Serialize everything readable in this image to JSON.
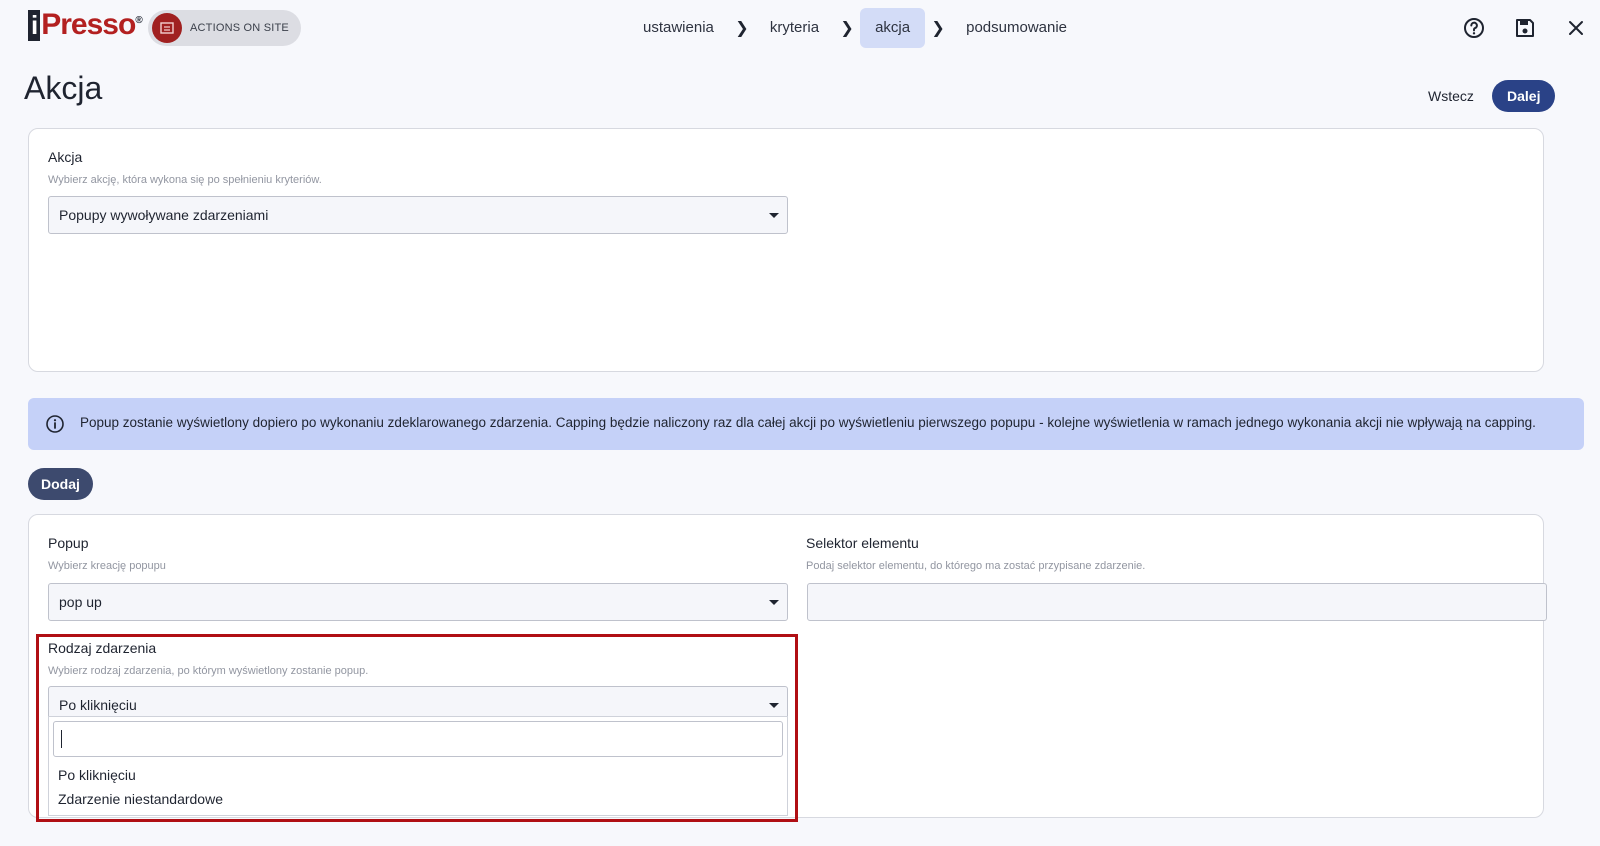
{
  "header": {
    "logo_text": "Presso",
    "logo_mark": "i",
    "logo_reg": "®",
    "badge_label": "ACTIONS ON SITE",
    "steps": [
      {
        "label": "ustawienia"
      },
      {
        "label": "kryteria"
      },
      {
        "label": "akcja",
        "active": true
      },
      {
        "label": "podsumowanie"
      }
    ],
    "icons": [
      "help-icon",
      "save-icon",
      "close-icon"
    ]
  },
  "page": {
    "title": "Akcja",
    "back_label": "Wstecz",
    "next_label": "Dalej"
  },
  "action_card": {
    "label": "Akcja",
    "hint": "Wybierz akcję, która wykona się po spełnieniu kryteriów.",
    "select_value": "Popupy wywoływane zdarzeniami"
  },
  "info": {
    "text": "Popup zostanie wyświetlony dopiero po wykonaniu zdeklarowanego zdarzenia. Capping będzie naliczony raz dla całej akcji po wyświetleniu pierwszego popupu - kolejne wyświetlenia w ramach jednego wykonania akcji nie wpływają na capping."
  },
  "add_label": "Dodaj",
  "popup_card": {
    "popup": {
      "label": "Popup",
      "hint": "Wybierz kreację popupu",
      "value": "pop up"
    },
    "selector": {
      "label": "Selektor elementu",
      "hint": "Podaj selektor elementu, do którego ma zostać przypisane zdarzenie.",
      "value": ""
    },
    "event_type": {
      "label": "Rodzaj zdarzenia",
      "hint": "Wybierz rodzaj zdarzenia, po którym wyświetlony zostanie popup.",
      "value": "Po kliknięciu",
      "search_value": "",
      "options": [
        "Po kliknięciu",
        "Zdarzenie niestandardowe"
      ]
    }
  },
  "colors": {
    "brand_red": "#b32020",
    "primary": "#2a4287",
    "active_step": "#d3dcf7",
    "info_bg": "#c5d1f8",
    "highlight": "#b00f14"
  }
}
